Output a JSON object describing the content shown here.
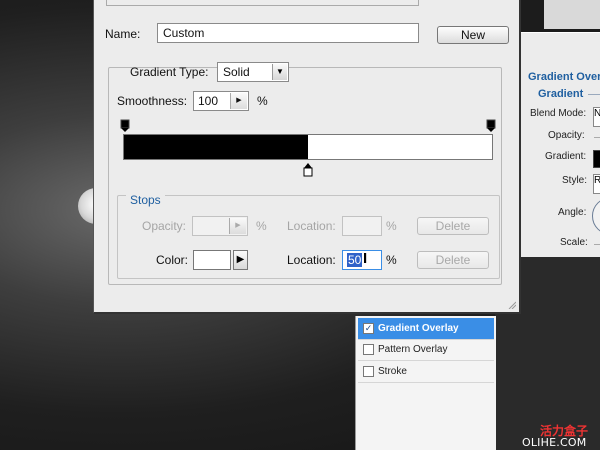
{
  "dialog": {
    "name_label": "Name:",
    "name_value": "Custom",
    "new_button": "New",
    "gradient_type_label": "Gradient Type:",
    "gradient_type_value": "Solid",
    "smoothness_label": "Smoothness:",
    "smoothness_value": "100",
    "smoothness_unit": "%",
    "gradient": {
      "left_color": "#000000",
      "right_color": "#ffffff",
      "split_fraction": 0.5
    },
    "stops": {
      "title": "Stops",
      "opacity_label": "Opacity:",
      "opacity_value": "",
      "opacity_unit": "%",
      "location_label": "Location:",
      "opacity_location_value": "",
      "opacity_location_unit": "%",
      "delete_label": "Delete",
      "color_label": "Color:",
      "color_value": "#ffffff",
      "color_location_label": "Location:",
      "color_location_value": "50",
      "color_location_unit": "%",
      "color_delete_label": "Delete"
    }
  },
  "layer_style": {
    "title": "Gradient Overl",
    "subtitle": "Gradient",
    "blend_mode_label": "Blend Mode:",
    "blend_mode_value": "N",
    "opacity_label": "Opacity:",
    "gradient_label": "Gradient:",
    "style_label": "Style:",
    "style_value": "R",
    "angle_label": "Angle:",
    "scale_label": "Scale:"
  },
  "styles_list": [
    {
      "label": "Gradient Overlay",
      "checked": true,
      "selected": true
    },
    {
      "label": "Pattern Overlay",
      "checked": false,
      "selected": false
    },
    {
      "label": "Stroke",
      "checked": false,
      "selected": false
    }
  ],
  "watermark": {
    "line1": "活力盒子",
    "line2": "OLIHE.COM"
  },
  "colors": {
    "accent": "#1f5fa0",
    "selection": "#3a8ee6",
    "dialog_bg": "#ececec"
  }
}
